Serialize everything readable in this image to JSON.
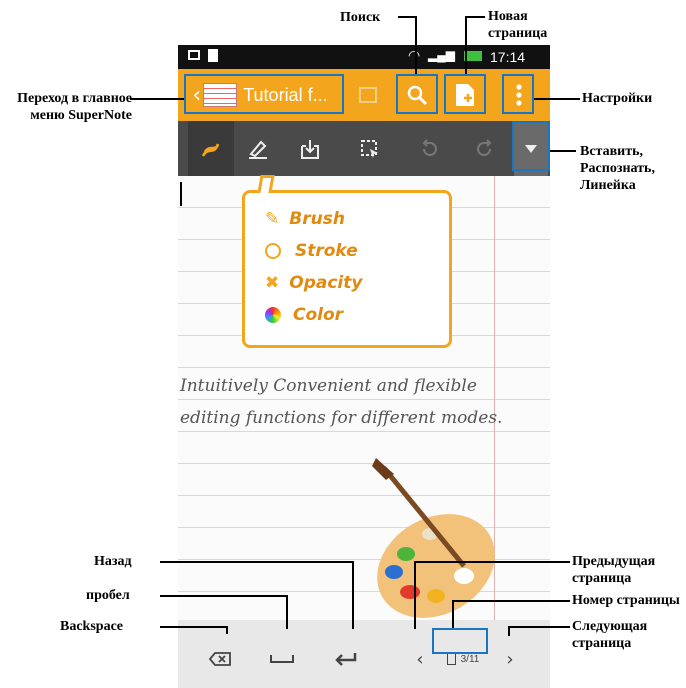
{
  "status_bar": {
    "time": "17:14"
  },
  "action_bar": {
    "notebook_title": "Tutorial f..."
  },
  "legend": {
    "items": [
      {
        "label": "Brush",
        "icon": "brush-icon"
      },
      {
        "label": "Stroke",
        "icon": "circle-icon"
      },
      {
        "label": "Opacity",
        "icon": "opacity-icon"
      },
      {
        "label": "Color",
        "icon": "color-wheel-icon"
      }
    ]
  },
  "handwriting": {
    "line1": "Intuitively Convenient and flexible",
    "line2": "editing functions for different modes."
  },
  "bottom_bar": {
    "page_indicator": "3/11"
  },
  "callouts": {
    "search": "Поиск",
    "new_page": "Новая страница",
    "main_menu": "Переход в главное меню SuperNote",
    "settings": "Настройки",
    "insert": "Вставить, Распознать, Линейка",
    "back": "Назад",
    "space": "пробел",
    "backspace": "Backspace",
    "prev_page": "Предыдущая страница",
    "page_number": "Номер страницы",
    "next_page": "Следующая страница"
  },
  "colors": {
    "accent": "#f3a51d",
    "callout_box": "#1976c2",
    "toolbar": "#4a4a4a"
  }
}
